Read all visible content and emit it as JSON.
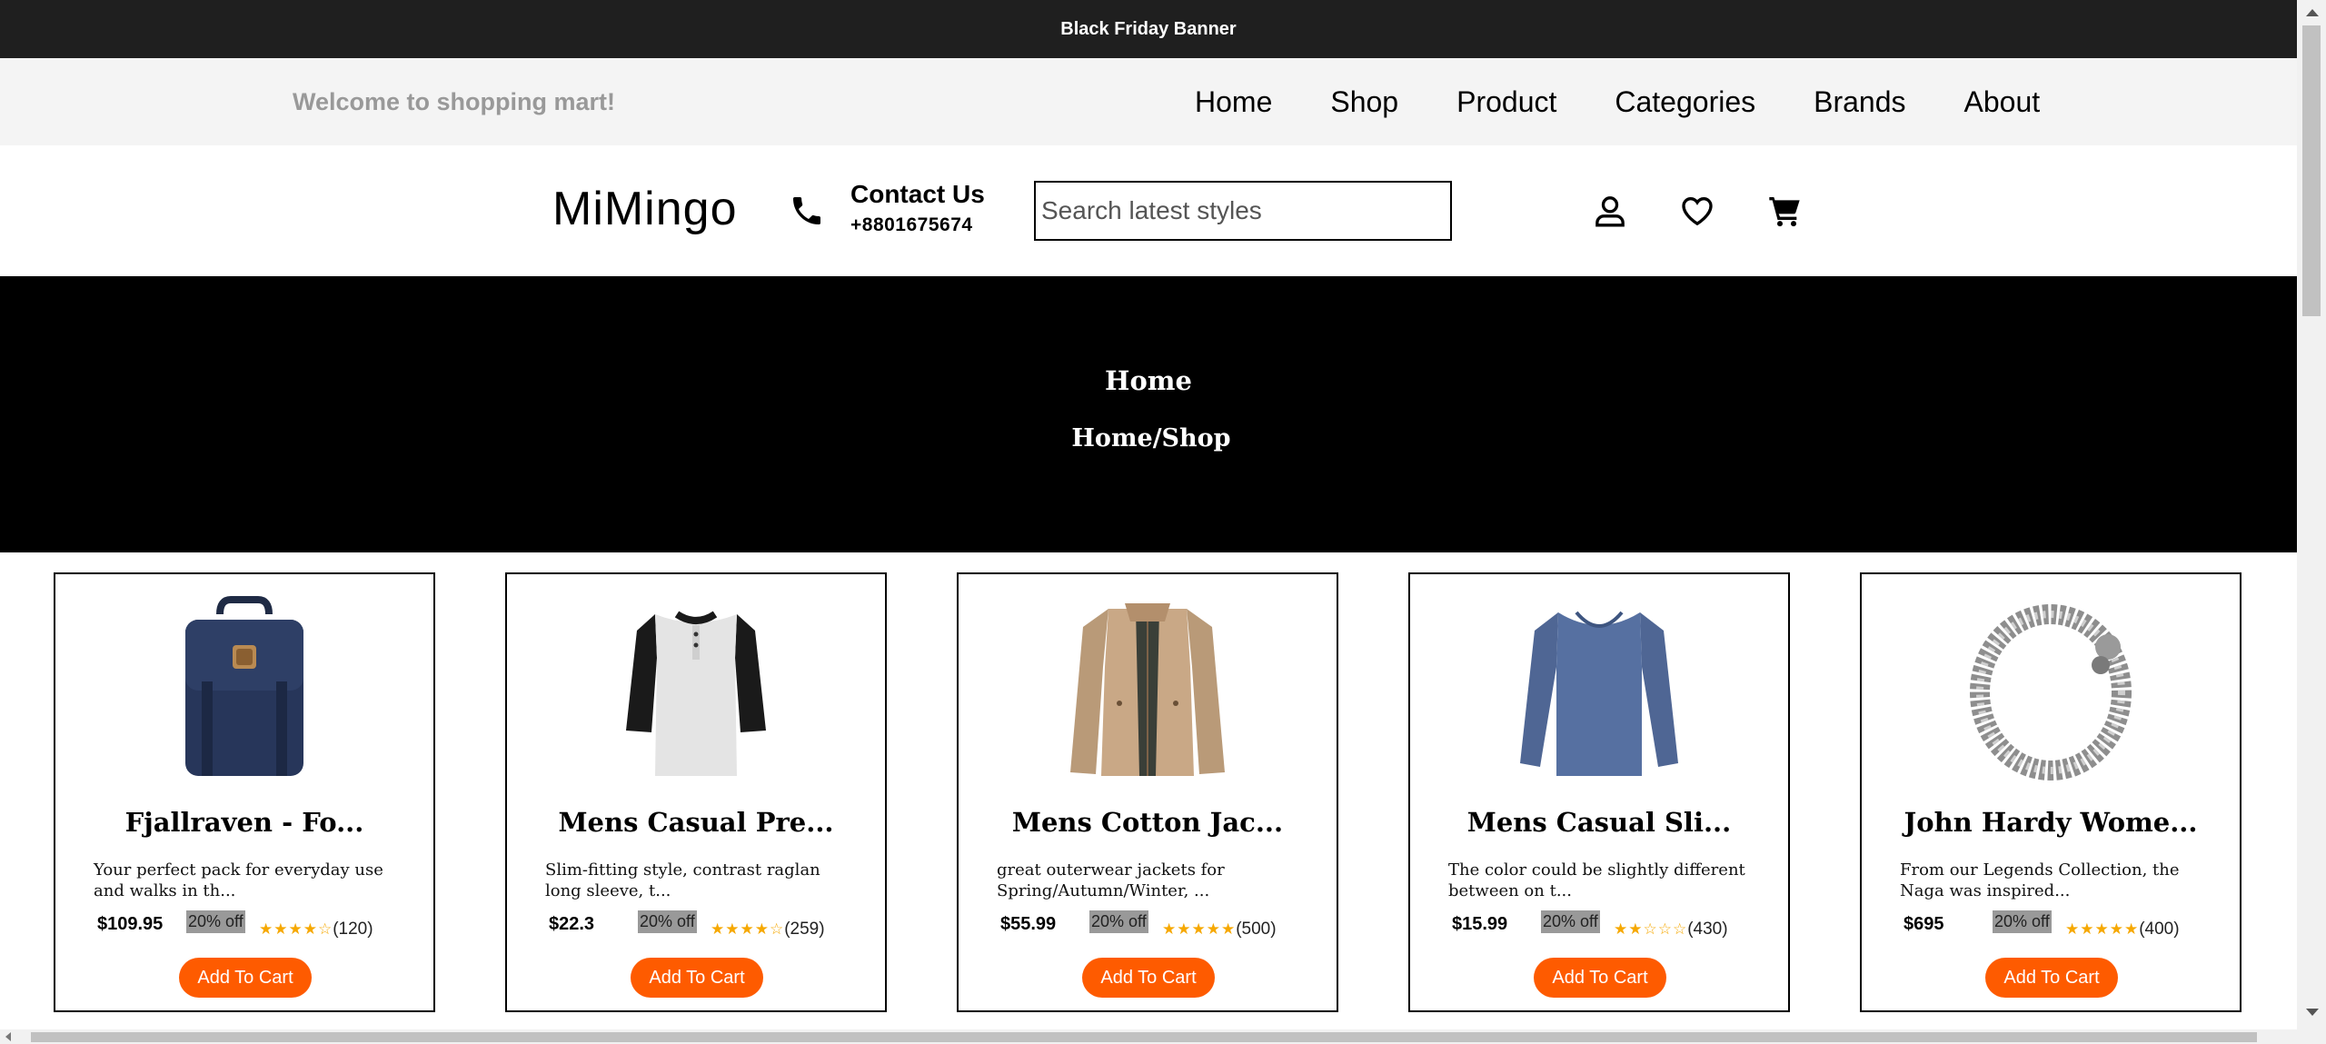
{
  "top_banner": {
    "text": "Black Friday Banner"
  },
  "navbar": {
    "welcome": "Welcome to shopping mart!",
    "links": [
      "Home",
      "Shop",
      "Product",
      "Categories",
      "Brands",
      "About"
    ]
  },
  "header": {
    "brand": "MiMingo",
    "contact_title": "Contact Us",
    "contact_phone": "+8801675674",
    "search_placeholder": "Search latest styles",
    "icons": [
      "user-icon",
      "heart-icon",
      "cart-icon"
    ]
  },
  "hero": {
    "title": "Home",
    "breadcrumb": "Home/Shop"
  },
  "products": [
    {
      "title": "Fjallraven - Fo...",
      "desc": "Your perfect pack for everyday use and walks in th...",
      "price": "$109.95",
      "discount": "20% off",
      "stars": "★★★★☆",
      "rating": 4,
      "count": "(120)",
      "button": "Add To Cart",
      "image": "backpack"
    },
    {
      "title": "Mens Casual Pre...",
      "desc": "Slim-fitting style, contrast raglan long sleeve, t...",
      "price": "$22.3",
      "discount": "20% off",
      "stars": "★★★★☆",
      "rating": 4,
      "count": "(259)",
      "button": "Add To Cart",
      "image": "raglan-tshirt"
    },
    {
      "title": "Mens Cotton Jac...",
      "desc": "great outerwear jackets for Spring/Autumn/Winter, ...",
      "price": "$55.99",
      "discount": "20% off",
      "stars": "★★★★★",
      "rating": 5,
      "count": "(500)",
      "button": "Add To Cart",
      "image": "jacket"
    },
    {
      "title": "Mens Casual Sli...",
      "desc": "The color could be slightly different between on t...",
      "price": "$15.99",
      "discount": "20% off",
      "stars": "★★☆☆☆",
      "rating": 2,
      "count": "(430)",
      "button": "Add To Cart",
      "image": "long-sleeve"
    },
    {
      "title": "John Hardy Wome...",
      "desc": "From our Legends Collection, the Naga was inspired...",
      "price": "$695",
      "discount": "20% off",
      "stars": "★★★★★",
      "rating": 5,
      "count": "(400)",
      "button": "Add To Cart",
      "image": "bracelet"
    }
  ],
  "colors": {
    "accent": "#fe5b00",
    "star": "#f6a800",
    "topbar": "#1f1f1f",
    "hero": "#000000",
    "navbar": "#f4f4f4"
  }
}
